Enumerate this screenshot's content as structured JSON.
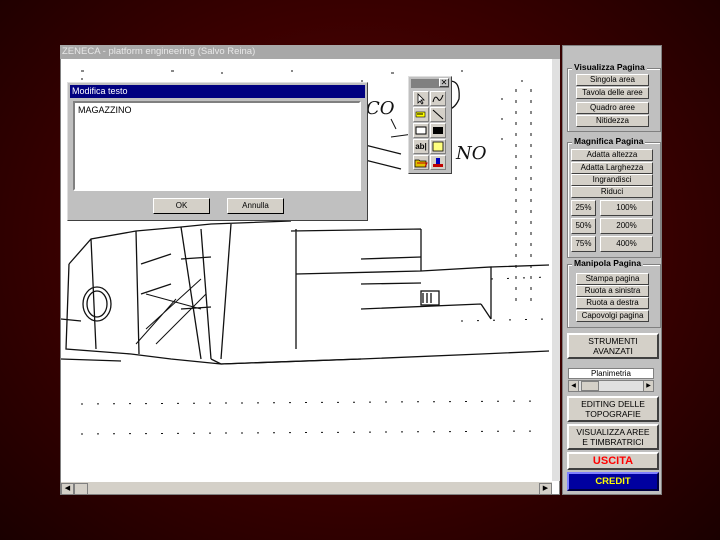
{
  "window": {
    "title": "ZENECA - platform engineering (Salvo Reina)"
  },
  "dialog": {
    "title": "Modifica testo",
    "text_value": "MAGAZZINO",
    "ok_label": "OK",
    "cancel_label": "Annulla"
  },
  "toolbox": {
    "close_glyph": "✕",
    "text_tool_label": "ab|"
  },
  "panel": {
    "visualizza": {
      "title": "Visualizza Pagina",
      "buttons": [
        "Singola area",
        "Tavola delle aree",
        "Quadro aree",
        "Nitidezza"
      ]
    },
    "magnifica": {
      "title": "Magnifica Pagina",
      "buttons": [
        "Adatta altezza",
        "Adatta Larghezza",
        "Ingrandisci",
        "Riduci"
      ],
      "zoom": [
        "25%",
        "100%",
        "50%",
        "200%",
        "75%",
        "400%"
      ]
    },
    "manipola": {
      "title": "Manipola Pagina",
      "buttons": [
        "Stampa pagina",
        "Ruota a sinistra",
        "Ruota a destra",
        "Capovolgi pagina"
      ]
    },
    "strumenti_label": "STRUMENTI\nAVANZATI",
    "layer_select": "Planimetria",
    "editing_label": "EDITING DELLE\nTOPOGRAFIE",
    "visualizza_aree_label": "VISUALIZZA AREE\nE TIMBRATRICI",
    "uscita_label": "USCITA",
    "credit_label": "CREDIT",
    "colors": {
      "uscita": "#ff0000",
      "credit_bg": "#0000a0",
      "credit_text": "#ffff00"
    }
  },
  "drawing": {
    "handwriting": [
      "CO",
      "NO"
    ]
  }
}
